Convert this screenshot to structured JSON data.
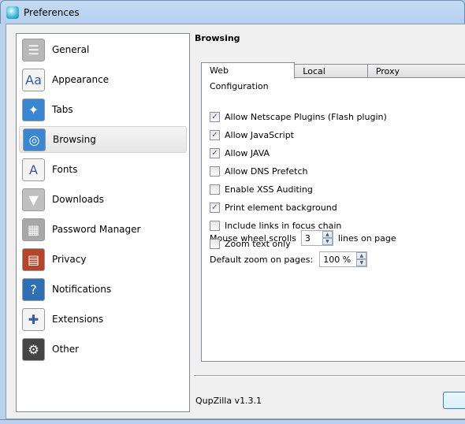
{
  "window": {
    "title": "Preferences"
  },
  "sidebar": {
    "items": [
      {
        "label": "General",
        "icon": "sliders-icon",
        "color": "#b8b8b8",
        "glyph": "☰"
      },
      {
        "label": "Appearance",
        "icon": "palette-icon",
        "color": "#f4f4f4",
        "glyph": "Aa"
      },
      {
        "label": "Tabs",
        "icon": "world-map-icon",
        "color": "#3a86d0",
        "glyph": "✦"
      },
      {
        "label": "Browsing",
        "icon": "compass-icon",
        "color": "#3a86d0",
        "glyph": "◎"
      },
      {
        "label": "Fonts",
        "icon": "font-icon",
        "color": "#f4f4f4",
        "glyph": "A"
      },
      {
        "label": "Downloads",
        "icon": "download-arrow-icon",
        "color": "#c0c0c0",
        "glyph": "▼"
      },
      {
        "label": "Password Manager",
        "icon": "keypad-icon",
        "color": "#a8a8a8",
        "glyph": "▦"
      },
      {
        "label": "Privacy",
        "icon": "brick-wall-icon",
        "color": "#b5452a",
        "glyph": "▤"
      },
      {
        "label": "Notifications",
        "icon": "question-bubble-icon",
        "color": "#2f6fb3",
        "glyph": "?"
      },
      {
        "label": "Extensions",
        "icon": "puzzle-icon",
        "color": "#f4f4f4",
        "glyph": "✚"
      },
      {
        "label": "Other",
        "icon": "gear-icon",
        "color": "#444444",
        "glyph": "⚙"
      }
    ],
    "selected": "Browsing"
  },
  "main": {
    "header": "Browsing",
    "tabs": [
      {
        "label": "Web Configuration",
        "active": true
      },
      {
        "label": "Local Storage",
        "active": false
      },
      {
        "label": "Proxy Configuration",
        "active": false
      }
    ],
    "checkboxes": [
      {
        "label": "Allow Netscape Plugins (Flash plugin)",
        "checked": true
      },
      {
        "label": "Allow JavaScript",
        "checked": true
      },
      {
        "label": "Allow JAVA",
        "checked": true
      },
      {
        "label": "Allow DNS Prefetch",
        "checked": false
      },
      {
        "label": "Enable XSS Auditing",
        "checked": false
      },
      {
        "label": "Print element background",
        "checked": true
      },
      {
        "label": "Include links in focus chain",
        "checked": false
      },
      {
        "label": "Zoom text only",
        "checked": false
      }
    ],
    "wheel": {
      "label": "Mouse wheel scrolls",
      "value": "3",
      "suffix": "lines on page"
    },
    "zoom": {
      "label": "Default zoom on pages:",
      "value": "100 %"
    }
  },
  "footer": {
    "version": "QupZilla v1.3.1"
  }
}
